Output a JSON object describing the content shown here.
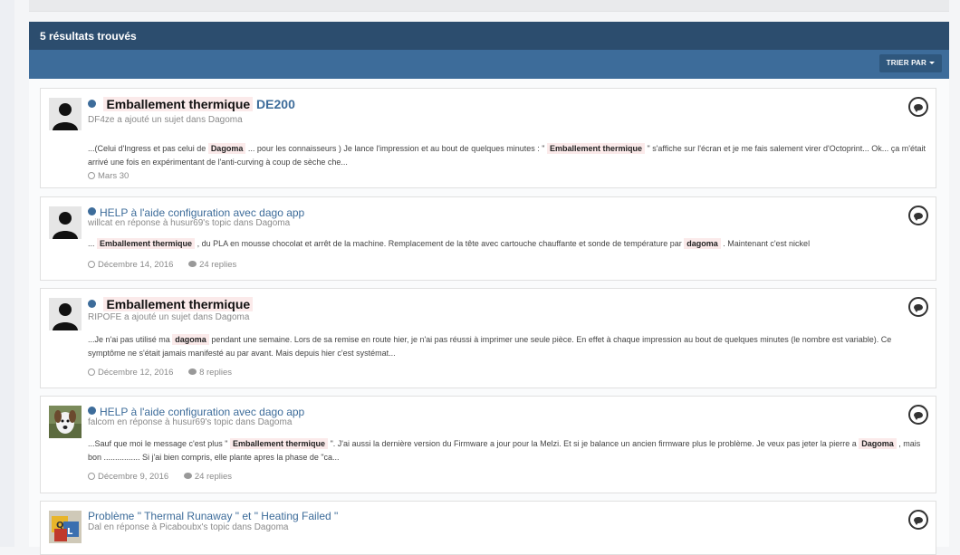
{
  "header": {
    "results_label": "5 résultats trouvés"
  },
  "toolbar": {
    "sort_label": "TRIER PAR"
  },
  "results": [
    {
      "title_hl": "Emballement  thermique",
      "title_rest": "DE200",
      "meta": "DF4ze a ajouté un sujet dans Dagoma",
      "snippet": {
        "p1": "...(Celui d'Ingress et pas celui de",
        "h1": "Dagoma",
        "p2": "... pour les connaisseurs ) Je lance l'impression et au bout de quelques minutes : \"",
        "h2": "Emballement  thermique",
        "p3": "\" s'affiche sur l'écran et je me fais salement virer d'Octoprint... Ok... ça m'était arrivé une fois en expérimentant de l'anti-curving à coup de sèche che..."
      },
      "date": "Mars 30",
      "replies": ""
    },
    {
      "title": "HELP à l'aide configuration avec dago app",
      "meta": "willcat en réponse à husur69's topic dans Dagoma",
      "snippet": {
        "p1": "...",
        "h1": "Emballement  thermique",
        "p2": ", du PLA en mousse chocolat et arrêt de la machine. Remplacement de la tête avec cartouche chauffante et sonde de température par",
        "h2": "dagoma",
        "p3": ". Maintenant c'est nickel"
      },
      "date": "Décembre 14, 2016",
      "replies": "24 replies"
    },
    {
      "title_hl": "Emballement  thermique",
      "meta": "RIPOFE a ajouté un sujet dans Dagoma",
      "snippet": {
        "p1": "...Je n'ai pas utilisé ma",
        "h1": "dagoma",
        "p2": "pendant une semaine. Lors de sa remise en route hier, je n'ai pas réussi à imprimer une seule pièce. En effet à chaque impression au bout de quelques minutes (le nombre est variable). Ce symptôme ne s'était jamais manifesté au par avant. Mais depuis hier c'est systémat...",
        "h2": "",
        "p3": ""
      },
      "date": "Décembre 12, 2016",
      "replies": "8 replies"
    },
    {
      "title": "HELP à l'aide configuration avec dago app",
      "meta": "falcom en réponse à husur69's topic dans Dagoma",
      "snippet": {
        "p1": "...Sauf que moi le message c'est plus \"",
        "h1": "Emballement  thermique",
        "p2": "\". J'ai aussi la dernière version du Firmware a jour pour la Melzi. Et si je balance un ancien firmware plus le problème. Je veux pas jeter la pierre a",
        "h2": "Dagoma",
        "p3": ", mais bon ................ Si j'ai bien compris, elle plante apres la phase de \"ca..."
      },
      "date": "Décembre 9, 2016",
      "replies": "24 replies"
    },
    {
      "title": "Problème \" Thermal Runaway \" et \" Heating Failed \"",
      "meta": "Dal en réponse à Picaboubx's topic dans Dagoma",
      "snippet": {
        "p1": "",
        "h1": "",
        "p2": "",
        "h2": "",
        "p3": ""
      },
      "date": "",
      "replies": ""
    }
  ],
  "icons": {
    "date": "clock-icon",
    "replies": "speech-bubble-icon",
    "comment": "comment-icon",
    "status": "unread-dot-icon"
  },
  "colors": {
    "header": "#2c4d6e",
    "subbar": "#3d6c9a",
    "highlight": "#fbeaea",
    "link": "#3d6c9a"
  }
}
